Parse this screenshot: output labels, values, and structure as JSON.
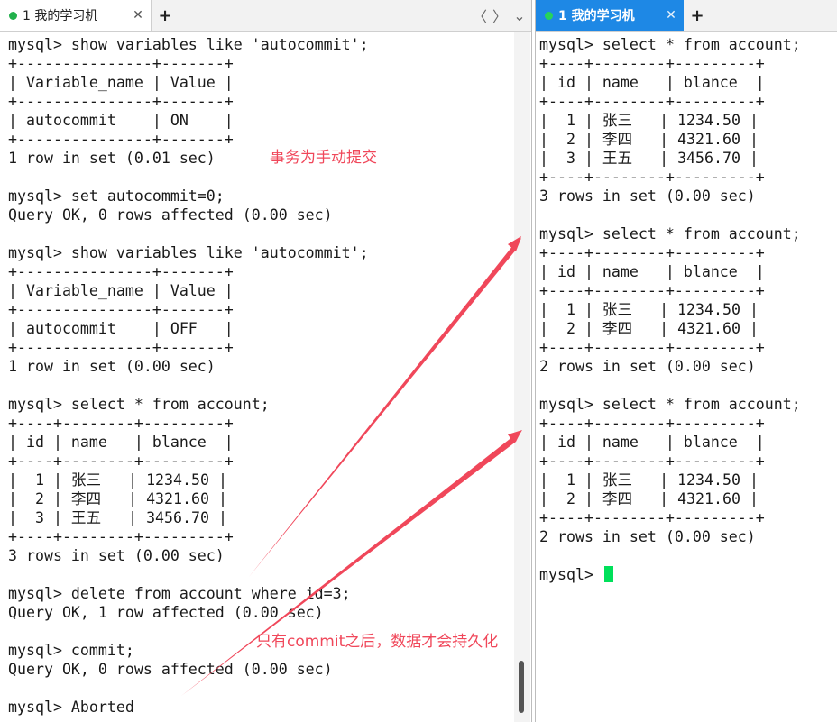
{
  "left_pane": {
    "tab": {
      "label": "1 我的学习机",
      "close": "✕"
    },
    "add_tab": "+",
    "nav": {
      "prev": "〈",
      "next": "〉",
      "menu": "⌄"
    },
    "lines": [
      "mysql> show variables like 'autocommit';",
      "+---------------+-------+",
      "| Variable_name | Value |",
      "+---------------+-------+",
      "| autocommit    | ON    |",
      "+---------------+-------+",
      "1 row in set (0.01 sec)",
      "",
      "mysql> set autocommit=0;",
      "Query OK, 0 rows affected (0.00 sec)",
      "",
      "mysql> show variables like 'autocommit';",
      "+---------------+-------+",
      "| Variable_name | Value |",
      "+---------------+-------+",
      "| autocommit    | OFF   |",
      "+---------------+-------+",
      "1 row in set (0.00 sec)",
      "",
      "mysql> select * from account;",
      "+----+--------+---------+",
      "| id | name   | blance  |",
      "+----+--------+---------+",
      "|  1 | 张三   | 1234.50 |",
      "|  2 | 李四   | 4321.60 |",
      "|  3 | 王五   | 3456.70 |",
      "+----+--------+---------+",
      "3 rows in set (0.00 sec)",
      "",
      "mysql> delete from account where id=3;",
      "Query OK, 1 row affected (0.00 sec)",
      "",
      "mysql> commit;",
      "Query OK, 0 rows affected (0.00 sec)",
      "",
      "mysql> Aborted"
    ]
  },
  "right_pane": {
    "tab": {
      "label": "1 我的学习机",
      "close": "✕"
    },
    "add_tab": "+",
    "lines": [
      "mysql> select * from account;",
      "+----+--------+---------+",
      "| id | name   | blance  |",
      "+----+--------+---------+",
      "|  1 | 张三   | 1234.50 |",
      "|  2 | 李四   | 4321.60 |",
      "|  3 | 王五   | 3456.70 |",
      "+----+--------+---------+",
      "3 rows in set (0.00 sec)",
      "",
      "mysql> select * from account;",
      "+----+--------+---------+",
      "| id | name   | blance  |",
      "+----+--------+---------+",
      "|  1 | 张三   | 1234.50 |",
      "|  2 | 李四   | 4321.60 |",
      "+----+--------+---------+",
      "2 rows in set (0.00 sec)",
      "",
      "mysql> select * from account;",
      "+----+--------+---------+",
      "| id | name   | blance  |",
      "+----+--------+---------+",
      "|  1 | 张三   | 1234.50 |",
      "|  2 | 李四   | 4321.60 |",
      "+----+--------+---------+",
      "2 rows in set (0.00 sec)",
      ""
    ],
    "prompt": "mysql> "
  },
  "annotations": {
    "manual_commit": "事务为手动提交",
    "persist_note": "只有commit之后，数据才会持久化"
  },
  "colors": {
    "annotation": "#f0475a",
    "active_tab": "#1e88e5",
    "status_dot": "#22b14c",
    "cursor": "#00e05a"
  }
}
